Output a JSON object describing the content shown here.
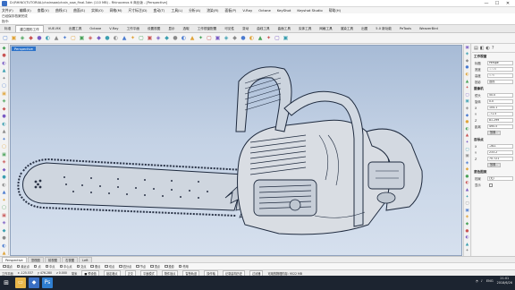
{
  "window": {
    "title": "D:\\RHINO\\TUTORIAL\\chainsaw\\chain_saw_final.3dm (110 MB) - Rhinoceros 6 商业版 - [Perspective]",
    "controls": [
      "—",
      "☐",
      "✕"
    ]
  },
  "menu": [
    "文件(F)",
    "编辑(E)",
    "查看(V)",
    "曲线(C)",
    "曲面(S)",
    "实体(O)",
    "网格(M)",
    "尺寸标注(D)",
    "变动(T)",
    "工具(L)",
    "分析(A)",
    "渲染(R)",
    "面板(P)",
    "V-Ray",
    "Octane",
    "KeyShot",
    "Keyshot Studio",
    "帮助(H)"
  ],
  "command": {
    "history": "已经保存档案完成",
    "prompt": "指令:"
  },
  "tabs": [
    "标准",
    "建立图形工作",
    "VUE-MX",
    "出图工具",
    "Octane",
    "V-Ray",
    "工作平面",
    "设置视图",
    "显示",
    "选取",
    "工作视窗配置",
    "可见性",
    "变动",
    "曲线工具",
    "曲面工具",
    "实体工具",
    "网格工具",
    "渲染工具",
    "出图",
    "5.0 新功能",
    "PeTools",
    "WeaverBird"
  ],
  "active_tab": 1,
  "toolbar_icons": [
    "new-icon",
    "open-icon",
    "save-icon",
    "print-icon",
    "cut-icon",
    "copy-icon",
    "paste-icon",
    "undo-icon",
    "redo-icon",
    "pan-icon",
    "rotate-icon",
    "zoom-icon",
    "zoom-window-icon",
    "zoom-extents-icon",
    "zoom-selected-icon",
    "select-icon",
    "layer-icon",
    "properties-icon",
    "render-icon",
    "material-icon",
    "light-icon",
    "grid-icon",
    "snap-icon",
    "osnap-icon",
    "planar-icon",
    "history-icon",
    "shade-icon",
    "wire-icon",
    "ghost-icon",
    "xray-icon",
    "tech-icon",
    "artistic-icon",
    "pen-icon",
    "help-icon"
  ],
  "viewport": {
    "label": "Perspective",
    "colors": {
      "background_top": "#a7bbd6",
      "background_bottom": "#d6e0ee",
      "model_fill": "#d9dde3",
      "model_edge": "#1e2a3e",
      "bar_fill": "#ccd4de"
    }
  },
  "panel": {
    "sections": {
      "viewport": "工作视窗",
      "camera": "摄像机",
      "target": "目标点",
      "wallpaper": "底色图案"
    },
    "fields": [
      {
        "key": "标题",
        "value": "Perspe"
      },
      {
        "key": "宽度",
        "value": "1728",
        "dim": true
      },
      {
        "key": "高度",
        "value": "576",
        "dim": true
      },
      {
        "key": "投影",
        "value": "透视"
      }
    ],
    "camera": [
      {
        "key": "镜头",
        "value": "50.0"
      },
      {
        "key": "旋转",
        "value": "0.0"
      },
      {
        "key": "X",
        "value": "104.1"
      },
      {
        "key": "Y",
        "value": "-71.5"
      },
      {
        "key": "Z",
        "value": "81.299"
      },
      {
        "key": "距离",
        "value": "495.5"
      }
    ],
    "camera_button": "放置...",
    "target": [
      {
        "key": "X",
        "value": "-282."
      },
      {
        "key": "Y",
        "value": "233.2"
      },
      {
        "key": "Z",
        "value": "70.721"
      }
    ],
    "target_button": "放置...",
    "wallpaper": [
      {
        "key": "档案",
        "value": "(无)"
      }
    ],
    "wallpaper_check": "显示"
  },
  "view_tabs": [
    "Perspective",
    "顶视图",
    "前视图",
    "右视图",
    "Left"
  ],
  "active_view": 0,
  "osnaps": [
    "端点",
    "最近点",
    "点",
    "中点",
    "中心点",
    "交点",
    "垂点",
    "切点",
    "四分点",
    "节点",
    "顶点",
    "投影",
    "停用"
  ],
  "status": [
    {
      "text": "工作平面",
      "box": false
    },
    {
      "text": "x -125.537",
      "box": false
    },
    {
      "text": "y 476.280",
      "box": false
    },
    {
      "text": "z 0.000",
      "box": false
    },
    {
      "text": "毫米",
      "box": false
    },
    {
      "text": "■ 预设值",
      "box": true
    },
    {
      "text": "锁定格点",
      "box": true
    },
    {
      "text": "正交",
      "box": true
    },
    {
      "text": "平面模式",
      "box": true
    },
    {
      "text": "物件锁点",
      "box": true
    },
    {
      "text": "智慧轨迹",
      "box": true
    },
    {
      "text": "操作轴",
      "box": true
    },
    {
      "text": "记录建构历史",
      "box": true
    },
    {
      "text": "过滤器",
      "box": true
    },
    {
      "text": "可用的物理内存: 9522 MB",
      "box": false
    }
  ],
  "taskbar": {
    "apps": [
      "file-explorer-icon",
      "rhino-icon",
      "photoshop-icon"
    ],
    "lang": "ENG",
    "time": "21:01",
    "date": "2018/6/26"
  }
}
